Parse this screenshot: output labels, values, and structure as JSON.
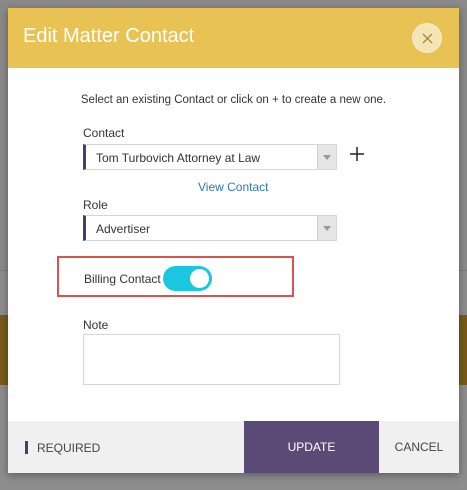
{
  "modal": {
    "title": "Edit Matter Contact",
    "instruction": "Select an existing Contact or click on + to create a new one.",
    "contact": {
      "label": "Contact",
      "value": "Tom Turbovich Attorney at Law",
      "add_symbol": "+",
      "view_link": "View Contact"
    },
    "role": {
      "label": "Role",
      "value": "Advertiser"
    },
    "billing_contact": {
      "label": "Billing Contact",
      "enabled": true
    },
    "note": {
      "label": "Note",
      "value": ""
    },
    "footer": {
      "required_label": "REQUIRED",
      "update_label": "UPDATE",
      "cancel_label": "CANCEL"
    }
  },
  "colors": {
    "header": "#e8c253",
    "accent": "#5b4a75",
    "toggle_on": "#1bc6e0",
    "highlight": "#d9534f",
    "link": "#2a7ab8"
  },
  "icons": {
    "close": "close-icon",
    "add": "plus-icon",
    "dropdown": "caret-down-icon"
  }
}
